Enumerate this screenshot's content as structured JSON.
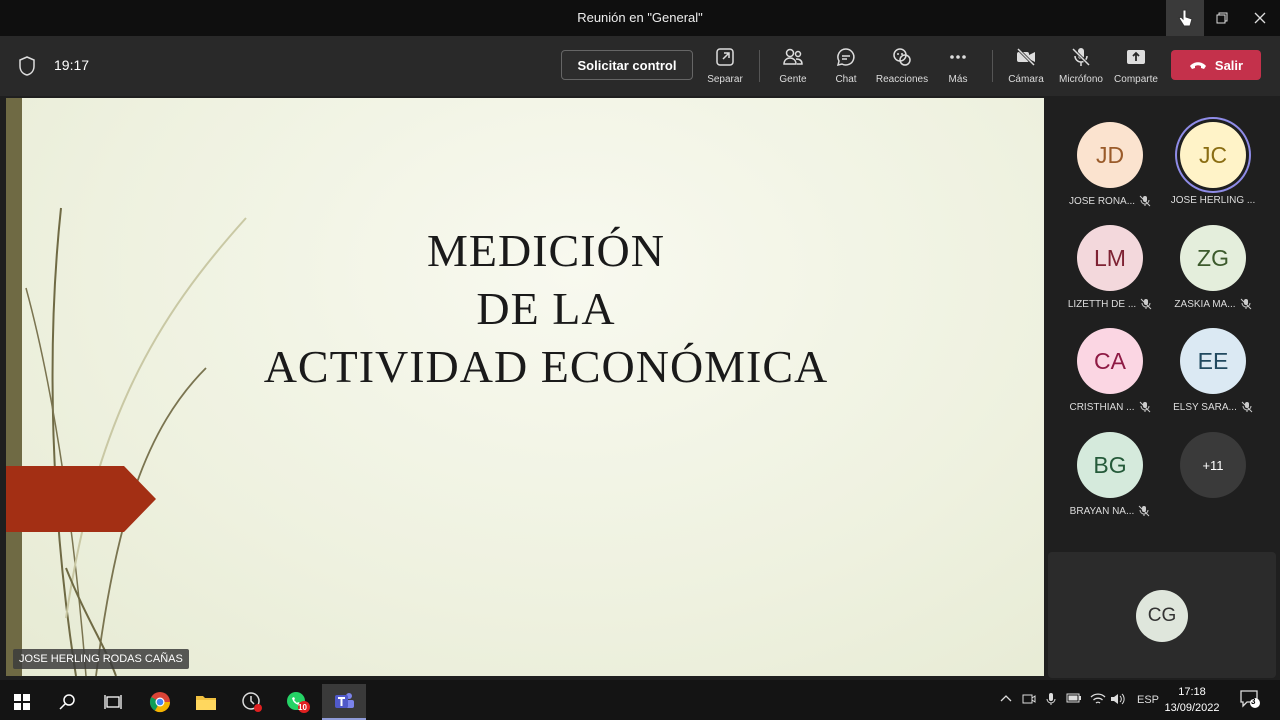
{
  "window": {
    "title": "Reunión en \"General\""
  },
  "toolbar": {
    "elapsed": "19:17",
    "request_control": "Solicitar control",
    "buttons": {
      "separar": "Separar",
      "gente": "Gente",
      "chat": "Chat",
      "reacciones": "Reacciones",
      "mas": "Más",
      "camara": "Cámara",
      "microfono": "Micrófono",
      "comparte": "Comparte"
    },
    "leave": "Salir"
  },
  "slide": {
    "line1": "MEDICIÓN",
    "line2": "DE LA",
    "line3": "ACTIVIDAD ECONÓMICA"
  },
  "presenter": "JOSE HERLING RODAS CAÑAS",
  "participants": [
    {
      "initials": "JD",
      "name": "JOSE RONA...",
      "bg": "#fbe3cf",
      "fg": "#9a5b2a"
    },
    {
      "initials": "JC",
      "name": "JOSE HERLING ...",
      "bg": "#fff3c8",
      "fg": "#8a6d13"
    },
    {
      "initials": "LM",
      "name": "LIZETTH DE ...",
      "bg": "#f3d8dc",
      "fg": "#7e2233"
    },
    {
      "initials": "ZG",
      "name": "ZASKIA MA...",
      "bg": "#e4eedc",
      "fg": "#3c5a2c"
    },
    {
      "initials": "CA",
      "name": "CRISTHIAN ...",
      "bg": "#fbd6e3",
      "fg": "#8e1a44"
    },
    {
      "initials": "EE",
      "name": "ELSY SARA...",
      "bg": "#dbe9f3",
      "fg": "#21495f"
    },
    {
      "initials": "BG",
      "name": "BRAYAN NA...",
      "bg": "#d5eadc",
      "fg": "#255a3a"
    },
    {
      "initials": "+11",
      "name": "",
      "bg": "#3a3a3a",
      "fg": "#ffffff"
    }
  ],
  "self": {
    "initials": "CG"
  },
  "taskbar": {
    "whatsapp_badge": "10",
    "language": "ESP",
    "time": "17:18",
    "date": "13/09/2022",
    "notifications": "3"
  },
  "colors": {
    "leave": "#c4314b",
    "speaking_ring": "#8f8ce8",
    "slide_arrow": "#a32f14"
  }
}
